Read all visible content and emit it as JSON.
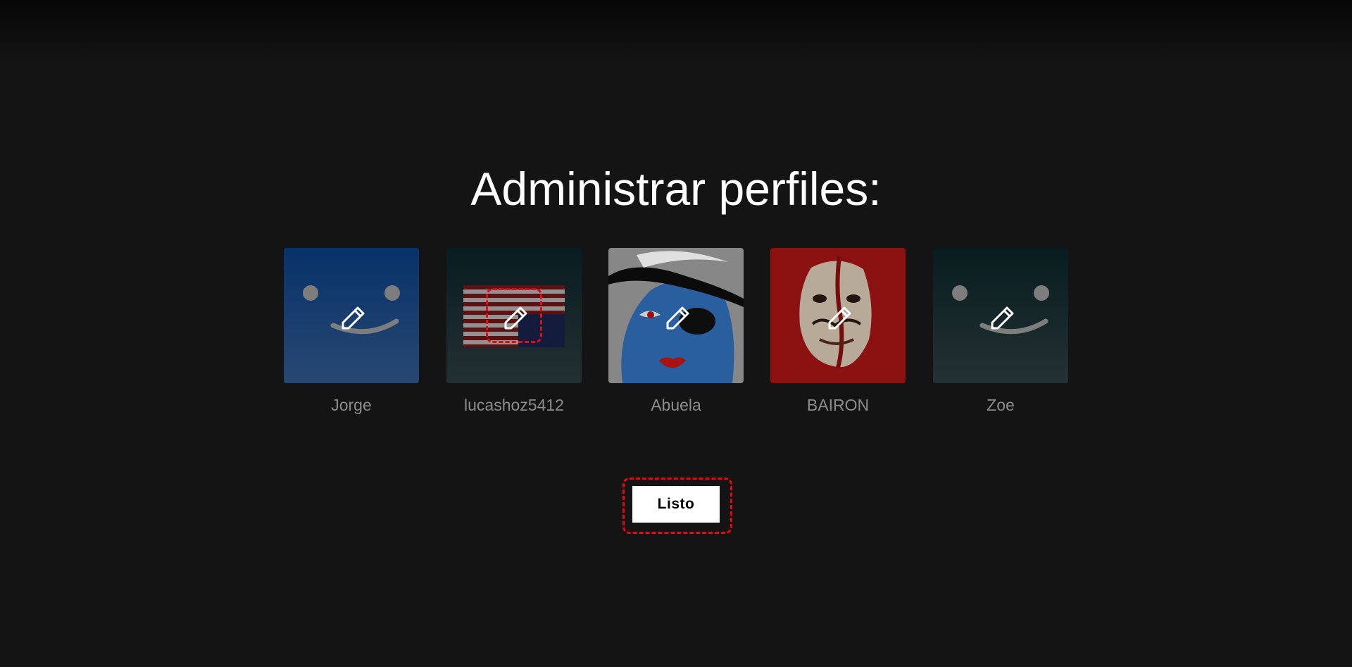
{
  "page": {
    "title": "Administrar perfiles:",
    "done_label": "Listo"
  },
  "colors": {
    "background": "#141414",
    "highlight": "#e50914",
    "name_text": "#8c8c8c"
  },
  "profiles": [
    {
      "name": "Jorge",
      "avatar": "smiley-blue"
    },
    {
      "name": "lucashoz5412",
      "avatar": "flag-stripes"
    },
    {
      "name": "Abuela",
      "avatar": "pirate-woman"
    },
    {
      "name": "BAIRON",
      "avatar": "dali-mask"
    },
    {
      "name": "Zoe",
      "avatar": "smiley-teal"
    }
  ],
  "icons": {
    "edit": "pencil-icon"
  }
}
